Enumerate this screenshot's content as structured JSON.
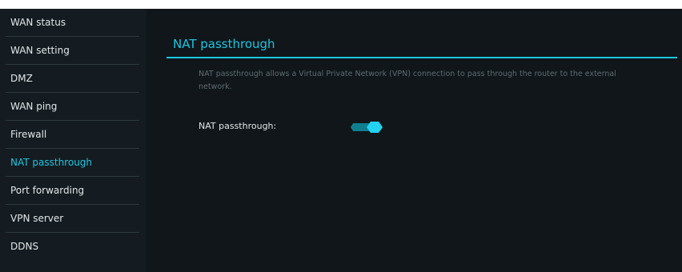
{
  "sidebar": {
    "items": [
      {
        "label": "WAN status",
        "active": false
      },
      {
        "label": "WAN setting",
        "active": false
      },
      {
        "label": "DMZ",
        "active": false
      },
      {
        "label": "WAN ping",
        "active": false
      },
      {
        "label": "Firewall",
        "active": false
      },
      {
        "label": "NAT passthrough",
        "active": true
      },
      {
        "label": "Port forwarding",
        "active": false
      },
      {
        "label": "VPN server",
        "active": false
      },
      {
        "label": "DDNS",
        "active": false
      }
    ]
  },
  "main": {
    "title": "NAT passthrough",
    "description": "NAT passthrough allows a Virtual Private Network (VPN) connection to pass through the router to the external network.",
    "fields": {
      "nat_passthrough": {
        "label": "NAT passthrough:",
        "enabled": true
      }
    }
  },
  "colors": {
    "accent": "#1ac6e2",
    "sidebar_bg": "#141c21",
    "main_bg": "#101619"
  }
}
